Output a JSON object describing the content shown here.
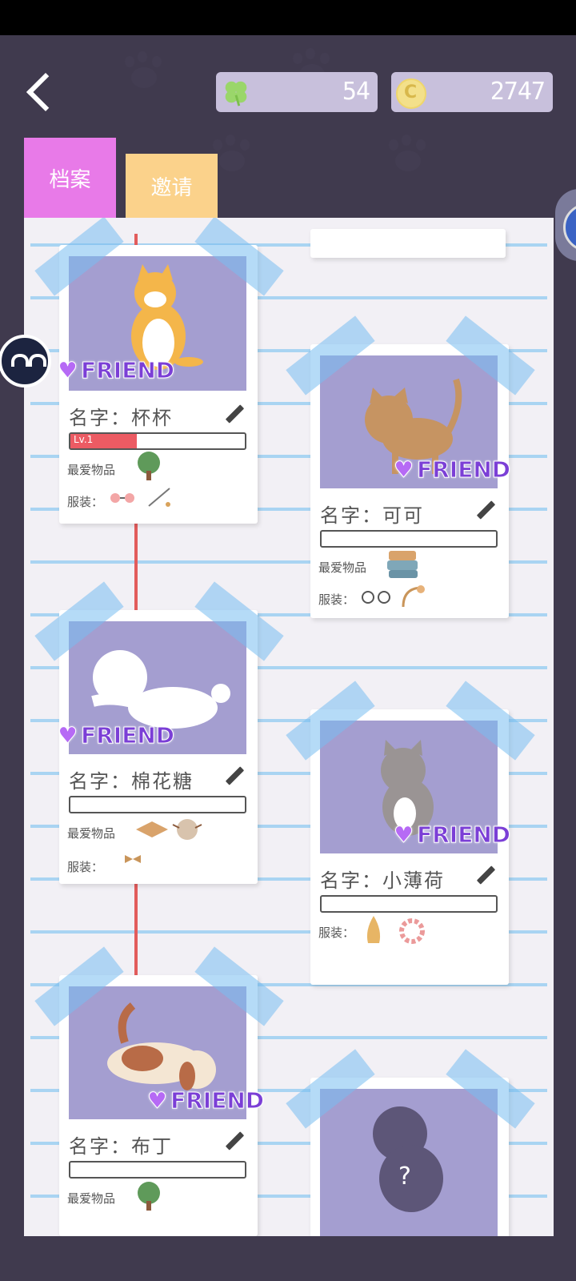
{
  "header": {
    "clover_value": "54",
    "coin_symbol": "C",
    "coin_value": "2747"
  },
  "tabs": [
    {
      "label": "档案"
    },
    {
      "label": "邀请"
    }
  ],
  "pets": [
    {
      "name_text": "名字：杯杯",
      "friend": "FRIEND",
      "level": "Lv.1",
      "bond_fraction": 0.38,
      "fav_label": "最爱物品",
      "outfit_label": "服装："
    },
    {
      "name_text": "名字：可可",
      "friend": "FRIEND",
      "bond_fraction": 0,
      "fav_label": "最爱物品",
      "outfit_label": "服装："
    },
    {
      "name_text": "名字：棉花糖",
      "friend": "FRIEND",
      "bond_fraction": 0,
      "fav_label": "最爱物品",
      "outfit_label": "服装："
    },
    {
      "name_text": "名字：小薄荷",
      "friend": "FRIEND",
      "bond_fraction": 0,
      "outfit_label": "服装："
    },
    {
      "name_text": "名字：布丁",
      "friend": "FRIEND",
      "bond_fraction": 0,
      "fav_label": "最爱物品"
    },
    {
      "locked_mark": "?"
    }
  ]
}
